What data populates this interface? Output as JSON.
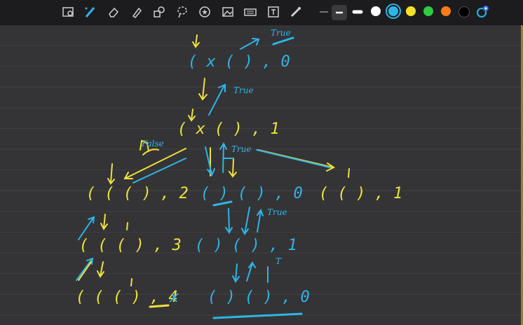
{
  "toolbar": {
    "tools": [
      "image-scan-icon",
      "pen-icon",
      "eraser-icon",
      "highlighter-icon",
      "shapes-icon",
      "lasso-icon",
      "sticker-icon",
      "image-icon",
      "keyboard-icon",
      "text-box-icon",
      "laser-pointer-icon"
    ],
    "colors": [
      "#ffffff",
      "#2fb4e8",
      "#f5e12a",
      "#2ecc40",
      "#ff7a1a",
      "#000000"
    ],
    "selected_color": "#2fb4e8"
  },
  "canvas": {
    "nodes": {
      "root": "( x ( ) , 0",
      "level1": "( x ( ) , 1",
      "left_a": "( ( ( ) , 2",
      "mid_a": "( ) ( ) , 0",
      "right_a": "( ( ) , 1",
      "left_b": "( ( ( ) , 3",
      "mid_b": "( ) ( ) , 1",
      "left_c": "( ( ( ) , 4",
      "left_c_mark": "x",
      "mid_c": "( ) ( ) , 0"
    },
    "notes": {
      "true_1": "True",
      "true_2": "True",
      "false_1": "False",
      "true_3": "True",
      "true_4": "True",
      "t_short": "T"
    }
  }
}
